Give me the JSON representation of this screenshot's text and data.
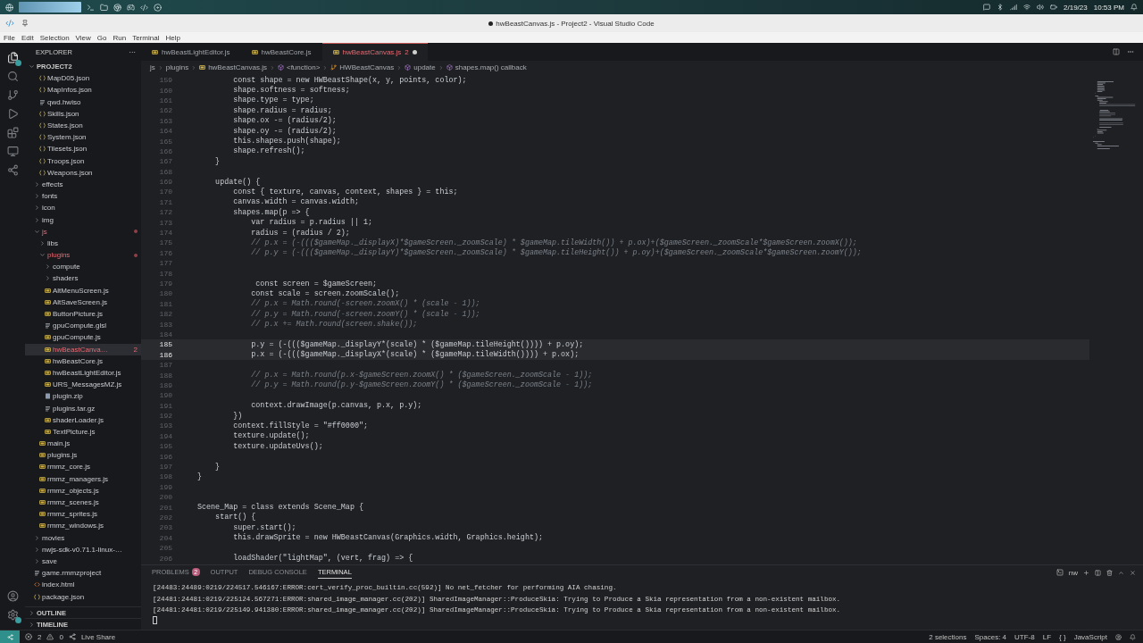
{
  "taskbar": {
    "date": "2/19/23",
    "clock": "10:53 PM"
  },
  "window": {
    "title": "hwBeastCanvas.js - Project2 - Visual Studio Code",
    "dirty": true
  },
  "menu": [
    "File",
    "Edit",
    "Selection",
    "View",
    "Go",
    "Run",
    "Terminal",
    "Help"
  ],
  "explorer": {
    "title": "EXPLORER",
    "more": "···",
    "root": {
      "label": "PROJECT2",
      "expanded": true
    },
    "items": [
      {
        "kind": "group",
        "children": [
          {
            "label": "MapD05.json",
            "kind": "json",
            "selected": false,
            "error": false
          },
          {
            "label": "MapInfos.json",
            "kind": "json",
            "selected": false,
            "error": false
          },
          {
            "label": "qwd.hwiso",
            "kind": "file",
            "selected": false,
            "error": false
          },
          {
            "label": "Skills.json",
            "kind": "json",
            "selected": false,
            "error": false
          },
          {
            "label": "States.json",
            "kind": "json",
            "selected": false,
            "error": false
          },
          {
            "label": "System.json",
            "kind": "json",
            "selected": false,
            "error": false
          },
          {
            "label": "Tilesets.json",
            "kind": "json",
            "selected": false,
            "error": false
          },
          {
            "label": "Troops.json",
            "kind": "json",
            "selected": false,
            "error": false
          },
          {
            "label": "Weapons.json",
            "kind": "json",
            "selected": false,
            "error": false
          }
        ]
      },
      {
        "label": "effects",
        "kind": "folder",
        "expanded": false,
        "selected": false,
        "error": false
      },
      {
        "label": "fonts",
        "kind": "folder",
        "expanded": false,
        "selected": false,
        "error": false
      },
      {
        "label": "icon",
        "kind": "folder",
        "expanded": false,
        "selected": false,
        "error": false
      },
      {
        "label": "img",
        "kind": "folder",
        "expanded": false,
        "selected": false,
        "error": false
      },
      {
        "label": "js",
        "kind": "folder",
        "expanded": true,
        "selected": false,
        "error": true,
        "children": [
          {
            "label": "libs",
            "kind": "folder",
            "expanded": false,
            "selected": false,
            "error": false
          },
          {
            "label": "plugins",
            "kind": "folder",
            "expanded": true,
            "selected": false,
            "error": true,
            "children": [
              {
                "label": "compute",
                "kind": "folder",
                "expanded": false,
                "selected": false,
                "error": false
              },
              {
                "label": "shaders",
                "kind": "folder",
                "expanded": false,
                "selected": false,
                "error": false
              },
              {
                "label": "AltMenuScreen.js",
                "kind": "js",
                "selected": false,
                "error": false
              },
              {
                "label": "AltSaveScreen.js",
                "kind": "js",
                "selected": false,
                "error": false
              },
              {
                "label": "ButtonPicture.js",
                "kind": "js",
                "selected": false,
                "error": false
              },
              {
                "label": "gpuCompute.glsl",
                "kind": "file",
                "selected": false,
                "error": false
              },
              {
                "label": "gpuCompute.js",
                "kind": "js",
                "selected": false,
                "error": false
              },
              {
                "label": "hwBeastCanva…",
                "kind": "js",
                "selected": true,
                "error": true,
                "badge": "2"
              },
              {
                "label": "hwBeastCore.js",
                "kind": "js",
                "selected": false,
                "error": false
              },
              {
                "label": "hwBeastLightEditor.js",
                "kind": "js",
                "selected": false,
                "error": false
              },
              {
                "label": "URS_MessagesMZ.js",
                "kind": "js",
                "selected": false,
                "error": false
              },
              {
                "label": "plugin.zip",
                "kind": "zip",
                "selected": false,
                "error": false
              },
              {
                "label": "plugins.tar.gz",
                "kind": "file",
                "selected": false,
                "error": false
              },
              {
                "label": "shaderLoader.js",
                "kind": "js",
                "selected": false,
                "error": false
              },
              {
                "label": "TextPicture.js",
                "kind": "js",
                "selected": false,
                "error": false
              }
            ]
          },
          {
            "label": "main.js",
            "kind": "js",
            "selected": false,
            "error": false
          },
          {
            "label": "plugins.js",
            "kind": "js",
            "selected": false,
            "error": false
          },
          {
            "label": "rmmz_core.js",
            "kind": "js",
            "selected": false,
            "error": false
          },
          {
            "label": "rmmz_managers.js",
            "kind": "js",
            "selected": false,
            "error": false
          },
          {
            "label": "rmmz_objects.js",
            "kind": "js",
            "selected": false,
            "error": false
          },
          {
            "label": "rmmz_scenes.js",
            "kind": "js",
            "selected": false,
            "error": false
          },
          {
            "label": "rmmz_sprites.js",
            "kind": "js",
            "selected": false,
            "error": false
          },
          {
            "label": "rmmz_windows.js",
            "kind": "js",
            "selected": false,
            "error": false
          }
        ]
      },
      {
        "label": "movies",
        "kind": "folder",
        "expanded": false,
        "selected": false,
        "error": false
      },
      {
        "label": "nwjs-sdk-v0.71.1-linux-…",
        "kind": "folder",
        "expanded": false,
        "selected": false,
        "error": false
      },
      {
        "label": "save",
        "kind": "folder",
        "expanded": false,
        "selected": false,
        "error": false
      },
      {
        "label": "game.rmmzproject",
        "kind": "file",
        "selected": false,
        "error": false
      },
      {
        "label": "index.html",
        "kind": "html",
        "selected": false,
        "error": false
      },
      {
        "label": "package.json",
        "kind": "json",
        "selected": false,
        "error": false
      }
    ],
    "sections": [
      {
        "label": "OUTLINE",
        "expanded": false
      },
      {
        "label": "TIMELINE",
        "expanded": false
      }
    ]
  },
  "tabs": [
    {
      "label": "hwBeastLightEditor.js",
      "selected": false,
      "modified": false
    },
    {
      "label": "hwBeastCore.js",
      "selected": false,
      "modified": false
    },
    {
      "label": "hwBeastCanvas.js",
      "selected": true,
      "modified": true,
      "badge": "2"
    }
  ],
  "breadcrumbs": [
    {
      "label": "js",
      "kind": "folder"
    },
    {
      "label": "plugins",
      "kind": "folder"
    },
    {
      "label": "hwBeastCanvas.js",
      "kind": "js"
    },
    {
      "label": "<function>",
      "kind": "symbol"
    },
    {
      "label": "HWBeastCanvas",
      "kind": "class"
    },
    {
      "label": "update",
      "kind": "symbol"
    },
    {
      "label": "shapes.map() callback",
      "kind": "symbol"
    }
  ],
  "code": [
    {
      "n": "159",
      "kind": "code",
      "highlighted": false,
      "text": "        const shape = new HWBeastShape(x, y, points, color);"
    },
    {
      "n": "160",
      "kind": "code",
      "highlighted": false,
      "text": "        shape.softness = softness;"
    },
    {
      "n": "161",
      "kind": "code",
      "highlighted": false,
      "text": "        shape.type = type;"
    },
    {
      "n": "162",
      "kind": "code",
      "highlighted": false,
      "text": "        shape.radius = radius;"
    },
    {
      "n": "163",
      "kind": "code",
      "highlighted": false,
      "text": "        shape.ox -= (radius/2);"
    },
    {
      "n": "164",
      "kind": "code",
      "highlighted": false,
      "text": "        shape.oy -= (radius/2);"
    },
    {
      "n": "165",
      "kind": "code",
      "highlighted": false,
      "text": "        this.shapes.push(shape);"
    },
    {
      "n": "166",
      "kind": "code",
      "highlighted": false,
      "text": "        shape.refresh();"
    },
    {
      "n": "167",
      "kind": "code",
      "highlighted": false,
      "text": "    }"
    },
    {
      "n": "168",
      "highlighted": false
    },
    {
      "n": "169",
      "kind": "code",
      "highlighted": false,
      "text": "    update() {"
    },
    {
      "n": "170",
      "kind": "code",
      "highlighted": false,
      "text": "        const { texture, canvas, context, shapes } = this;"
    },
    {
      "n": "171",
      "kind": "code",
      "highlighted": false,
      "text": "        canvas.width = canvas.width;"
    },
    {
      "n": "172",
      "kind": "code",
      "highlighted": false,
      "text": "        shapes.map(p => {"
    },
    {
      "n": "173",
      "kind": "code",
      "highlighted": false,
      "text": "            var radius = p.radius || 1;"
    },
    {
      "n": "174",
      "kind": "code",
      "highlighted": false,
      "text": "            radius = (radius / 2);"
    },
    {
      "n": "175",
      "kind": "comment",
      "highlighted": false,
      "text": "            // p.x = (-((($gameMap._displayX)*$gameScreen._zoomScale) * $gameMap.tileWidth()) + p.ox)+($gameScreen._zoomScale*$gameScreen.zoomX());"
    },
    {
      "n": "176",
      "kind": "comment",
      "highlighted": false,
      "text": "            // p.y = (-((($gameMap._displayY)*$gameScreen._zoomScale) * $gameMap.tileHeight()) + p.oy)+($gameScreen._zoomScale*$gameScreen.zoomY());"
    },
    {
      "n": "177",
      "highlighted": false
    },
    {
      "n": "178",
      "highlighted": false
    },
    {
      "n": "179",
      "kind": "code",
      "highlighted": false,
      "text": "             const screen = $gameScreen;"
    },
    {
      "n": "180",
      "kind": "code",
      "highlighted": false,
      "text": "            const scale = screen.zoomScale();"
    },
    {
      "n": "181",
      "kind": "comment",
      "highlighted": false,
      "text": "            // p.x = Math.round(-screen.zoomX() * (scale - 1));"
    },
    {
      "n": "182",
      "kind": "comment",
      "highlighted": false,
      "text": "            // p.y = Math.round(-screen.zoomY() * (scale - 1));"
    },
    {
      "n": "183",
      "kind": "comment",
      "highlighted": false,
      "text": "            // p.x += Math.round(screen.shake());"
    },
    {
      "n": "184",
      "highlighted": false
    },
    {
      "n": "185",
      "kind": "code",
      "highlighted": true,
      "text": "            p.y = (-((($gameMap._displayY*(scale) * ($gameMap.tileHeight()))) + p.oy);"
    },
    {
      "n": "186",
      "kind": "code",
      "highlighted": true,
      "text": "            p.x = (-((($gameMap._displayX*(scale) * ($gameMap.tileWidth()))) + p.ox);"
    },
    {
      "n": "187",
      "highlighted": false
    },
    {
      "n": "188",
      "kind": "comment",
      "highlighted": false,
      "text": "            // p.x = Math.round(p.x-$gameScreen.zoomX() * ($gameScreen._zoomScale - 1));"
    },
    {
      "n": "189",
      "kind": "comment",
      "highlighted": false,
      "text": "            // p.y = Math.round(p.y-$gameScreen.zoomY() * ($gameScreen._zoomScale - 1));"
    },
    {
      "n": "190",
      "highlighted": false
    },
    {
      "n": "191",
      "kind": "code",
      "highlighted": false,
      "text": "            context.drawImage(p.canvas, p.x, p.y);"
    },
    {
      "n": "192",
      "kind": "code",
      "highlighted": false,
      "text": "        })"
    },
    {
      "n": "193",
      "kind": "code",
      "highlighted": false,
      "text": "        context.fillStyle = \"#ff0000\";"
    },
    {
      "n": "194",
      "kind": "code",
      "highlighted": false,
      "text": "        texture.update();"
    },
    {
      "n": "195",
      "kind": "code",
      "highlighted": false,
      "text": "        texture.updateUvs();"
    },
    {
      "n": "196",
      "highlighted": false
    },
    {
      "n": "197",
      "kind": "code",
      "highlighted": false,
      "text": "    }"
    },
    {
      "n": "198",
      "kind": "code",
      "highlighted": false,
      "text": "}"
    },
    {
      "n": "199",
      "highlighted": false
    },
    {
      "n": "200",
      "highlighted": false
    },
    {
      "n": "201",
      "kind": "code",
      "highlighted": false,
      "text": "Scene_Map = class extends Scene_Map {"
    },
    {
      "n": "202",
      "kind": "code",
      "highlighted": false,
      "text": "    start() {"
    },
    {
      "n": "203",
      "kind": "code",
      "highlighted": false,
      "text": "        super.start();"
    },
    {
      "n": "204",
      "kind": "code",
      "highlighted": false,
      "text": "        this.drawSprite = new HWBeastCanvas(Graphics.width, Graphics.height);"
    },
    {
      "n": "205",
      "highlighted": false
    },
    {
      "n": "206",
      "kind": "code",
      "highlighted": false,
      "text": "        loadShader(\"lightMap\", (vert, frag) => {"
    }
  ],
  "panel": {
    "tabs": [
      {
        "label": "PROBLEMS",
        "selected": false,
        "badge": "2"
      },
      {
        "label": "OUTPUT",
        "selected": false
      },
      {
        "label": "DEBUG CONSOLE",
        "selected": false
      },
      {
        "label": "TERMINAL",
        "selected": true
      }
    ],
    "terminal_name": "nw",
    "lines": [
      "[24483:24489:0219/224517.546167:ERROR:cert_verify_proc_builtin.cc(592)] No net_fetcher for performing AIA chasing.",
      "[24481:24481:0219/225124.567271:ERROR:shared_image_manager.cc(202)] SharedImageManager::ProduceSkia: Trying to Produce a Skia representation from a non-existent mailbox.",
      "[24481:24481:0219/225149.941380:ERROR:shared_image_manager.cc(202)] SharedImageManager::ProduceSkia: Trying to Produce a Skia representation from a non-existent mailbox."
    ]
  },
  "status_bar": {
    "errors": "2",
    "warnings": "0",
    "live_share": "Live Share",
    "items": [
      "2 selections",
      "Spaces: 4",
      "UTF-8",
      "LF",
      "{ }",
      "JavaScript"
    ]
  }
}
